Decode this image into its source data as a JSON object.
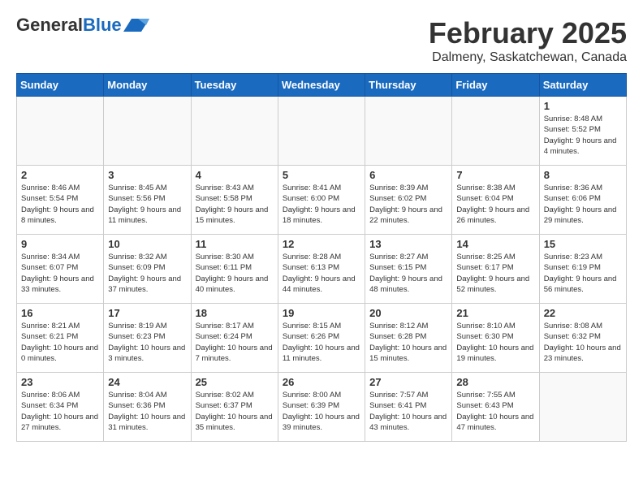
{
  "header": {
    "logo_general": "General",
    "logo_blue": "Blue",
    "month": "February 2025",
    "location": "Dalmeny, Saskatchewan, Canada"
  },
  "weekdays": [
    "Sunday",
    "Monday",
    "Tuesday",
    "Wednesday",
    "Thursday",
    "Friday",
    "Saturday"
  ],
  "weeks": [
    [
      {
        "day": "",
        "info": ""
      },
      {
        "day": "",
        "info": ""
      },
      {
        "day": "",
        "info": ""
      },
      {
        "day": "",
        "info": ""
      },
      {
        "day": "",
        "info": ""
      },
      {
        "day": "",
        "info": ""
      },
      {
        "day": "1",
        "info": "Sunrise: 8:48 AM\nSunset: 5:52 PM\nDaylight: 9 hours and 4 minutes."
      }
    ],
    [
      {
        "day": "2",
        "info": "Sunrise: 8:46 AM\nSunset: 5:54 PM\nDaylight: 9 hours and 8 minutes."
      },
      {
        "day": "3",
        "info": "Sunrise: 8:45 AM\nSunset: 5:56 PM\nDaylight: 9 hours and 11 minutes."
      },
      {
        "day": "4",
        "info": "Sunrise: 8:43 AM\nSunset: 5:58 PM\nDaylight: 9 hours and 15 minutes."
      },
      {
        "day": "5",
        "info": "Sunrise: 8:41 AM\nSunset: 6:00 PM\nDaylight: 9 hours and 18 minutes."
      },
      {
        "day": "6",
        "info": "Sunrise: 8:39 AM\nSunset: 6:02 PM\nDaylight: 9 hours and 22 minutes."
      },
      {
        "day": "7",
        "info": "Sunrise: 8:38 AM\nSunset: 6:04 PM\nDaylight: 9 hours and 26 minutes."
      },
      {
        "day": "8",
        "info": "Sunrise: 8:36 AM\nSunset: 6:06 PM\nDaylight: 9 hours and 29 minutes."
      }
    ],
    [
      {
        "day": "9",
        "info": "Sunrise: 8:34 AM\nSunset: 6:07 PM\nDaylight: 9 hours and 33 minutes."
      },
      {
        "day": "10",
        "info": "Sunrise: 8:32 AM\nSunset: 6:09 PM\nDaylight: 9 hours and 37 minutes."
      },
      {
        "day": "11",
        "info": "Sunrise: 8:30 AM\nSunset: 6:11 PM\nDaylight: 9 hours and 40 minutes."
      },
      {
        "day": "12",
        "info": "Sunrise: 8:28 AM\nSunset: 6:13 PM\nDaylight: 9 hours and 44 minutes."
      },
      {
        "day": "13",
        "info": "Sunrise: 8:27 AM\nSunset: 6:15 PM\nDaylight: 9 hours and 48 minutes."
      },
      {
        "day": "14",
        "info": "Sunrise: 8:25 AM\nSunset: 6:17 PM\nDaylight: 9 hours and 52 minutes."
      },
      {
        "day": "15",
        "info": "Sunrise: 8:23 AM\nSunset: 6:19 PM\nDaylight: 9 hours and 56 minutes."
      }
    ],
    [
      {
        "day": "16",
        "info": "Sunrise: 8:21 AM\nSunset: 6:21 PM\nDaylight: 10 hours and 0 minutes."
      },
      {
        "day": "17",
        "info": "Sunrise: 8:19 AM\nSunset: 6:23 PM\nDaylight: 10 hours and 3 minutes."
      },
      {
        "day": "18",
        "info": "Sunrise: 8:17 AM\nSunset: 6:24 PM\nDaylight: 10 hours and 7 minutes."
      },
      {
        "day": "19",
        "info": "Sunrise: 8:15 AM\nSunset: 6:26 PM\nDaylight: 10 hours and 11 minutes."
      },
      {
        "day": "20",
        "info": "Sunrise: 8:12 AM\nSunset: 6:28 PM\nDaylight: 10 hours and 15 minutes."
      },
      {
        "day": "21",
        "info": "Sunrise: 8:10 AM\nSunset: 6:30 PM\nDaylight: 10 hours and 19 minutes."
      },
      {
        "day": "22",
        "info": "Sunrise: 8:08 AM\nSunset: 6:32 PM\nDaylight: 10 hours and 23 minutes."
      }
    ],
    [
      {
        "day": "23",
        "info": "Sunrise: 8:06 AM\nSunset: 6:34 PM\nDaylight: 10 hours and 27 minutes."
      },
      {
        "day": "24",
        "info": "Sunrise: 8:04 AM\nSunset: 6:36 PM\nDaylight: 10 hours and 31 minutes."
      },
      {
        "day": "25",
        "info": "Sunrise: 8:02 AM\nSunset: 6:37 PM\nDaylight: 10 hours and 35 minutes."
      },
      {
        "day": "26",
        "info": "Sunrise: 8:00 AM\nSunset: 6:39 PM\nDaylight: 10 hours and 39 minutes."
      },
      {
        "day": "27",
        "info": "Sunrise: 7:57 AM\nSunset: 6:41 PM\nDaylight: 10 hours and 43 minutes."
      },
      {
        "day": "28",
        "info": "Sunrise: 7:55 AM\nSunset: 6:43 PM\nDaylight: 10 hours and 47 minutes."
      },
      {
        "day": "",
        "info": ""
      }
    ]
  ]
}
